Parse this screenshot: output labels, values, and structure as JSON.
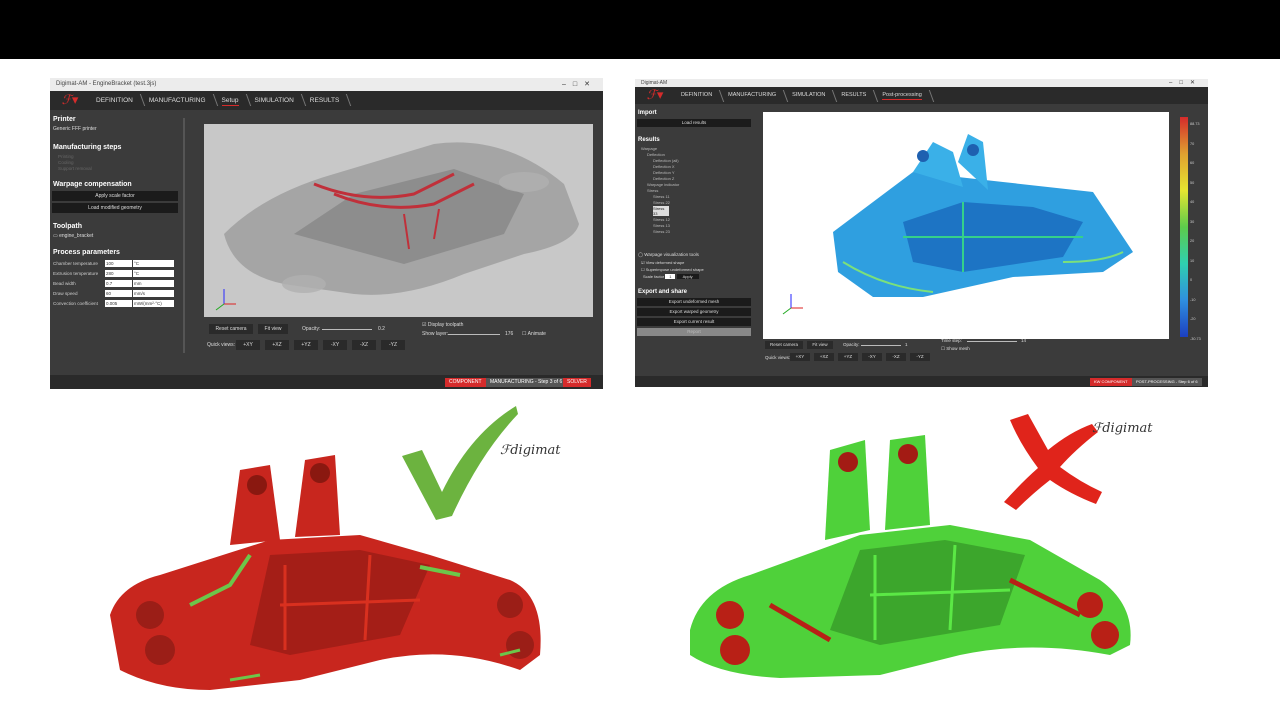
{
  "left_window": {
    "title": "Digimat-AM - EngineBracket (test.3js)",
    "tabs": [
      "DEFINITION",
      "MANUFACTURING",
      "Setup",
      "SIMULATION",
      "RESULTS"
    ],
    "printer_header": "Printer",
    "printer_name": "Generic FFF printer",
    "steps_header": "Manufacturing steps",
    "steps": [
      "Printing",
      "Cooling",
      "Support removal"
    ],
    "warpage_header": "Warpage compensation",
    "apply_scale_btn": "Apply scale factor",
    "load_geom_btn": "Load modified geometry",
    "toolpath_header": "Toolpath",
    "toolpath_file": "engine_bracket",
    "process_header": "Process parameters",
    "params": [
      {
        "label": "Chamber temperature",
        "value": "100",
        "unit": "°C"
      },
      {
        "label": "Extrusion temperature",
        "value": "280",
        "unit": "°C"
      },
      {
        "label": "Bead width",
        "value": "0.7",
        "unit": "mm"
      },
      {
        "label": "Draw speed",
        "value": "60",
        "unit": "mm/s"
      },
      {
        "label": "Convection coefficient",
        "value": "0.005",
        "unit": "mW/(mm²·°C)"
      }
    ],
    "reset_camera": "Reset camera",
    "fit_view": "Fit view",
    "opacity_label": "Opacity:",
    "opacity_value": "0.2",
    "display_toolpath": "Display toolpath",
    "show_layer_label": "Show layer:",
    "show_layer_value": "176",
    "animate": "Animate",
    "quick_views_label": "Quick views:",
    "quick_views": [
      "+XY",
      "+XZ",
      "+YZ",
      "-XY",
      "-XZ",
      "-YZ"
    ],
    "status_component": "COMPONENT",
    "status_step": "MANUFACTURING - Step 3 of 6",
    "status_solver": "SOLVER"
  },
  "right_window": {
    "title": "Digimat-AM",
    "tabs": [
      "DEFINITION",
      "MANUFACTURING",
      "SIMULATION",
      "RESULTS",
      "Post-processing"
    ],
    "import_header": "Import",
    "load_results_btn": "Load results",
    "results_header": "Results",
    "tree": [
      "Warpage",
      "Deflection",
      "Deflection (all)",
      "Deflection X",
      "Deflection Y",
      "Deflection Z",
      "Warpage indicator",
      "Stress",
      "Stress 11",
      "Stress 22",
      "Stress 33",
      "Stress 12",
      "Stress 13",
      "Stress 23"
    ],
    "warpage_tools": "Warpage visualization tools",
    "view_deformed": "View deformed shape",
    "superimpose": "Superimpose undeformed shape",
    "scale_factor_label": "Scale factor",
    "scale_factor_value": "1",
    "apply_btn": "Apply",
    "export_header": "Export and share",
    "export_btns": [
      "Export undeformed mesh",
      "Export warped geometry",
      "Export current result"
    ],
    "report_btn": "Report",
    "reset_camera": "Reset camera",
    "fit_view": "Fit view",
    "opacity_label": "Opacity:",
    "opacity_value": "1",
    "time_step_label": "Time step:",
    "time_step_value": "14",
    "show_mesh": "Show mesh",
    "quick_views_label": "Quick views:",
    "quick_views": [
      "+XY",
      "+XZ",
      "+YZ",
      "-XY",
      "-XZ",
      "-YZ"
    ],
    "legend_values": [
      "88.73",
      "70",
      "60",
      "50",
      "40",
      "30",
      "20",
      "10",
      "0",
      "-10",
      "-20",
      "-30.73"
    ],
    "status_component": "KW COMPONENT",
    "status_step": "POST-PROCESSING - Step 6 of 6"
  },
  "brand_left": "digimat",
  "brand_right": "digimat",
  "colors": {
    "accent_red": "#d52b2b",
    "good_green": "#6cb33f",
    "bad_red": "#e0241b"
  }
}
